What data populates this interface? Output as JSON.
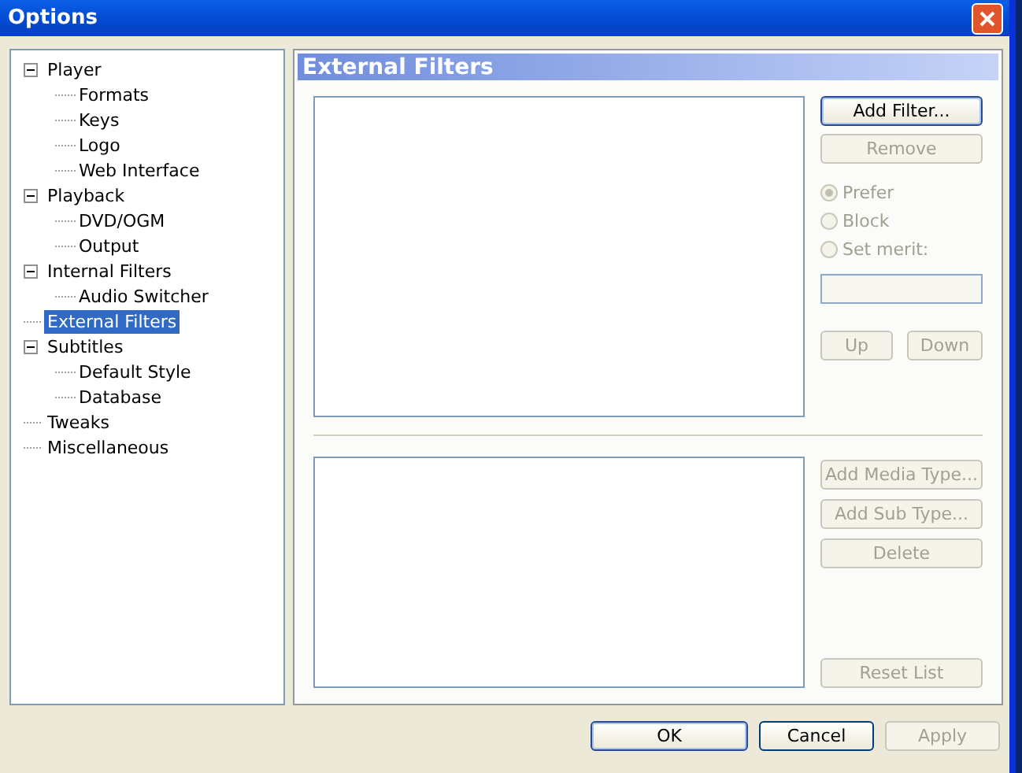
{
  "window": {
    "title": "Options"
  },
  "tree": [
    {
      "label": "Player",
      "expanded": true,
      "selected": false,
      "children": [
        {
          "label": "Formats",
          "selected": false
        },
        {
          "label": "Keys",
          "selected": false
        },
        {
          "label": "Logo",
          "selected": false
        },
        {
          "label": "Web Interface",
          "selected": false
        }
      ]
    },
    {
      "label": "Playback",
      "expanded": true,
      "selected": false,
      "children": [
        {
          "label": "DVD/OGM",
          "selected": false
        },
        {
          "label": "Output",
          "selected": false
        }
      ]
    },
    {
      "label": "Internal Filters",
      "expanded": true,
      "selected": false,
      "children": [
        {
          "label": "Audio Switcher",
          "selected": false
        }
      ]
    },
    {
      "label": "External Filters",
      "selected": true
    },
    {
      "label": "Subtitles",
      "expanded": true,
      "selected": false,
      "children": [
        {
          "label": "Default Style",
          "selected": false
        },
        {
          "label": "Database",
          "selected": false
        }
      ]
    },
    {
      "label": "Tweaks",
      "selected": false
    },
    {
      "label": "Miscellaneous",
      "selected": false
    }
  ],
  "page": {
    "title": "External Filters"
  },
  "filter_buttons": [
    {
      "label": "Add Filter...",
      "disabled": false,
      "focused": true
    },
    {
      "label": "Remove",
      "disabled": true,
      "focused": false
    }
  ],
  "merit_options": [
    {
      "label": "Prefer",
      "selected": true,
      "disabled": true
    },
    {
      "label": "Block",
      "selected": false,
      "disabled": true
    },
    {
      "label": "Set merit:",
      "selected": false,
      "disabled": true
    }
  ],
  "merit_field": {
    "disabled": true
  },
  "order_buttons": [
    {
      "label": "Up",
      "disabled": true
    },
    {
      "label": "Down",
      "disabled": true
    }
  ],
  "type_buttons": [
    {
      "label": "Add Media Type...",
      "disabled": true
    },
    {
      "label": "Add Sub Type...",
      "disabled": true
    },
    {
      "label": "Delete",
      "disabled": true
    }
  ],
  "reset_button": {
    "label": "Reset List",
    "disabled": true
  },
  "dialog_buttons": [
    {
      "label": "OK",
      "disabled": false,
      "focused": true
    },
    {
      "label": "Cancel",
      "disabled": false,
      "focused": false
    },
    {
      "label": "Apply",
      "disabled": true,
      "focused": false
    }
  ]
}
